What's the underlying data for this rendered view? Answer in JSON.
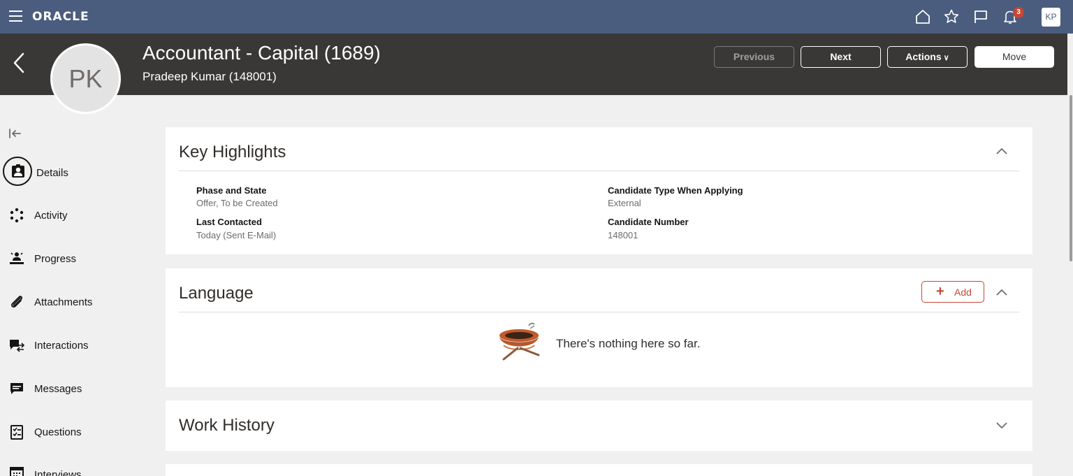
{
  "topbar": {
    "logo": "ORACLE",
    "notification_count": "3",
    "user_initials": "KP"
  },
  "header": {
    "title": "Accountant - Capital (1689)",
    "subtitle": "Pradeep Kumar (148001)",
    "avatar_initials": "PK",
    "buttons": {
      "previous": "Previous",
      "next": "Next",
      "actions": "Actions",
      "move": "Move"
    }
  },
  "sidebar": {
    "items": [
      {
        "label": "Details",
        "icon": "person-icon"
      },
      {
        "label": "Activity",
        "icon": "activity-icon"
      },
      {
        "label": "Progress",
        "icon": "progress-icon"
      },
      {
        "label": "Attachments",
        "icon": "paperclip-icon"
      },
      {
        "label": "Interactions",
        "icon": "interactions-icon"
      },
      {
        "label": "Messages",
        "icon": "message-icon"
      },
      {
        "label": "Questions",
        "icon": "questions-icon"
      },
      {
        "label": "Interviews",
        "icon": "calendar-icon"
      }
    ]
  },
  "key_highlights": {
    "title": "Key Highlights",
    "fields": [
      {
        "label": "Phase and State",
        "value": "Offer, To be Created"
      },
      {
        "label": "Candidate Type When Applying",
        "value": "External"
      },
      {
        "label": "Last Contacted",
        "value": "Today (Sent E-Mail)"
      },
      {
        "label": "Candidate Number",
        "value": "148001"
      }
    ]
  },
  "language": {
    "title": "Language",
    "add_label": "Add",
    "empty_message": "There's nothing here so far."
  },
  "work_history": {
    "title": "Work History"
  },
  "colors": {
    "topbar": "#4a5d7e",
    "header": "#3a3836",
    "accent": "#c74634"
  }
}
